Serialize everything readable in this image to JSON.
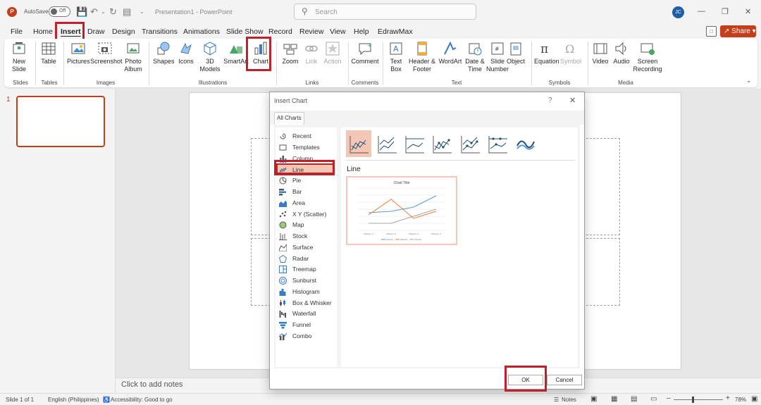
{
  "titlebar": {
    "autosave_label": "AutoSave",
    "autosave_state": "Off",
    "title": "Presentation1 - PowerPoint",
    "search_placeholder": "Search",
    "user_initials": "JC"
  },
  "menu": {
    "tabs": [
      "File",
      "Home",
      "Insert",
      "Draw",
      "Design",
      "Transitions",
      "Animations",
      "Slide Show",
      "Record",
      "Review",
      "View",
      "Help",
      "EdrawMax"
    ],
    "active": "Insert",
    "share_label": "Share"
  },
  "ribbon": {
    "buttons": {
      "new_slide": "New Slide",
      "table": "Table",
      "pictures": "Pictures",
      "screenshot": "Screenshot",
      "photo_album": "Photo Album",
      "shapes": "Shapes",
      "icons": "Icons",
      "models_3d": "3D Models",
      "smartart": "SmartArt",
      "chart": "Chart",
      "zoom": "Zoom",
      "link": "Link",
      "action": "Action",
      "comment": "Comment",
      "text_box": "Text Box",
      "header_footer": "Header & Footer",
      "wordart": "WordArt",
      "date_time": "Date & Time",
      "slide_number": "Slide Number",
      "object": "Object",
      "equation": "Equation",
      "symbol": "Symbol",
      "video": "Video",
      "audio": "Audio",
      "screen_recording": "Screen Recording"
    },
    "groups": {
      "slides": "Slides",
      "tables": "Tables",
      "images": "Images",
      "illustrations": "Illustrations",
      "links": "Links",
      "comments": "Comments",
      "text": "Text",
      "symbols": "Symbols",
      "media": "Media"
    }
  },
  "thumbnails": {
    "slide_number": "1"
  },
  "notes": {
    "placeholder": "Click to add notes"
  },
  "status": {
    "slide": "Slide 1 of 1",
    "language": "English (Philippines)",
    "accessibility": "Accessibility: Good to go",
    "notes": "Notes",
    "zoom": "78%"
  },
  "dialog": {
    "title": "Insert Chart",
    "help": "?",
    "close": "✕",
    "tab": "All Charts",
    "chart_types": [
      "Recent",
      "Templates",
      "Column",
      "Line",
      "Pie",
      "Bar",
      "Area",
      "X Y (Scatter)",
      "Map",
      "Stock",
      "Surface",
      "Radar",
      "Treemap",
      "Sunburst",
      "Histogram",
      "Box & Whisker",
      "Waterfall",
      "Funnel",
      "Combo"
    ],
    "selected_type": "Line",
    "heading": "Line",
    "preview": {
      "title": "Chart Title",
      "categories": [
        "Category 1",
        "Category 2",
        "Category 3",
        "Category 4"
      ],
      "series": [
        "Series1",
        "Series2",
        "Series3"
      ]
    },
    "ok_label": "OK",
    "cancel_label": "Cancel"
  },
  "colors": {
    "accent": "#c43e1c",
    "highlight": "#c0202a",
    "selection": "#f4c7b5",
    "series_blue": "#5b9bd5",
    "series_orange": "#ed7d31",
    "series_gray": "#a5a5a5"
  }
}
